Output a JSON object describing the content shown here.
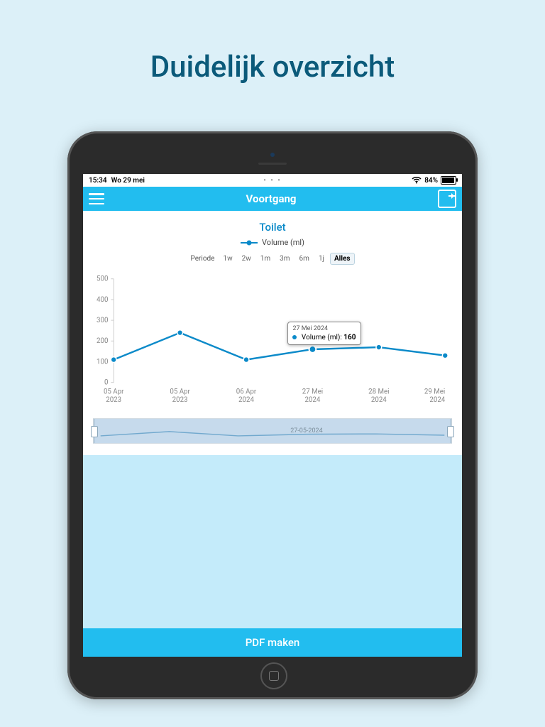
{
  "marketing_title": "Duidelijk overzicht",
  "statusbar": {
    "time": "15:34",
    "date": "Wo 29 mei",
    "center_dots": "• • •",
    "battery_pct": "84%"
  },
  "header": {
    "title": "Voortgang"
  },
  "chart_title": "Toilet",
  "legend_label": "Volume (ml)",
  "period_label": "Periode",
  "period_options": [
    "1w",
    "2w",
    "1m",
    "3m",
    "6m",
    "1j",
    "Alles"
  ],
  "period_selected": 6,
  "tooltip": {
    "title": "27 Mei 2024",
    "series": "Volume (ml):",
    "value": "160"
  },
  "navigator": {
    "label": "27-05-2024"
  },
  "pdf_button": "PDF maken",
  "y_ticks": [
    "0",
    "100",
    "200",
    "300",
    "400",
    "500"
  ],
  "x_labels": [
    {
      "top": "05 Apr",
      "bottom": "2023"
    },
    {
      "top": "05 Apr",
      "bottom": "2023"
    },
    {
      "top": "06 Apr",
      "bottom": "2024"
    },
    {
      "top": "27 Mei",
      "bottom": "2024"
    },
    {
      "top": "28 Mei",
      "bottom": "2024"
    },
    {
      "top": "29 Mei",
      "bottom": "2024"
    }
  ],
  "chart_data": {
    "type": "line",
    "title": "Toilet",
    "ylabel": "Volume (ml)",
    "xlabel": "",
    "ylim": [
      0,
      500
    ],
    "x": [
      "05 Apr 2023",
      "05 Apr 2023",
      "06 Apr 2024",
      "27 Mei 2024",
      "28 Mei 2024",
      "29 Mei 2024"
    ],
    "series": [
      {
        "name": "Volume (ml)",
        "values": [
          110,
          240,
          110,
          160,
          170,
          130
        ]
      }
    ],
    "highlighted_index": 3,
    "highlighted_tooltip": {
      "date": "27 Mei 2024",
      "value": 160
    }
  }
}
